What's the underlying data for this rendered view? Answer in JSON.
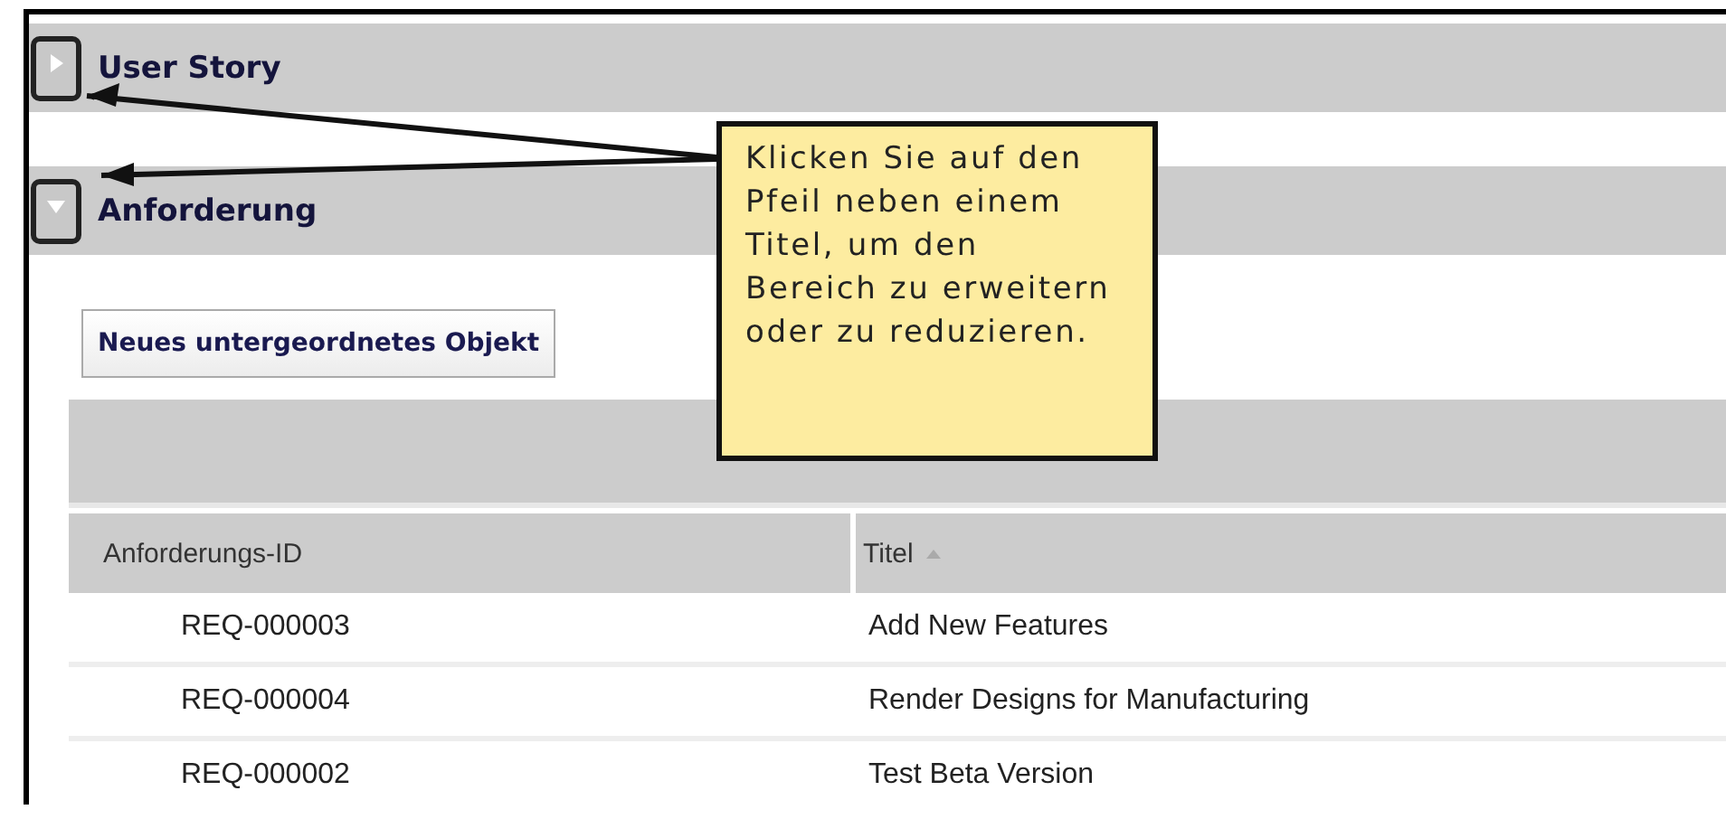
{
  "sections": [
    {
      "title": "User Story",
      "expanded": false
    },
    {
      "title": "Anforderung",
      "expanded": true,
      "toolbar": {
        "buttons": [
          "Neues untergeordnetes Objekt"
        ]
      },
      "table": {
        "columns": [
          {
            "label": "Anforderungs-ID",
            "sorted": false
          },
          {
            "label": "Titel",
            "sorted": true
          }
        ],
        "rows": [
          [
            "REQ-000003",
            "Add New Features"
          ],
          [
            "REQ-000004",
            "Render Designs for Manufacturing"
          ],
          [
            "REQ-000002",
            "Test Beta Version"
          ]
        ]
      }
    }
  ],
  "callout": {
    "text": "Klicken Sie auf den Pfeil neben einem Titel, um den Bereich zu erweitern oder zu reduzieren."
  }
}
